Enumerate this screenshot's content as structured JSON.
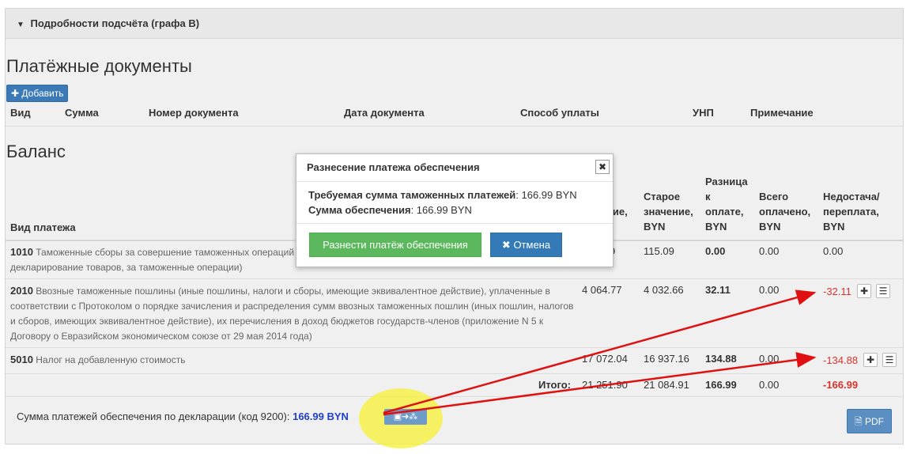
{
  "details_bar": {
    "arrow": "▼",
    "label": "Подробности подсчёта (графа В)"
  },
  "payment_docs": {
    "title": "Платёжные документы",
    "add_label": "Добавить",
    "columns": [
      "Вид",
      "Сумма",
      "Номер документа",
      "Дата документа",
      "Способ уплаты",
      "УНП",
      "Примечание"
    ]
  },
  "balance": {
    "title": "Баланс",
    "columns": {
      "type": "Вид платежа",
      "new_value_line1": "е",
      "new_value_line2": "ние,",
      "old_value": [
        "Старое",
        "значение,",
        "BYN"
      ],
      "difference": [
        "Разница",
        "к",
        "оплате,",
        "BYN"
      ],
      "paid_total": [
        "Всего",
        "оплачено,",
        "BYN"
      ],
      "shortage": [
        "Недостача/",
        "переплата,",
        "BYN"
      ]
    },
    "rows": [
      {
        "code": "1010",
        "desc_line1": "Таможенные сборы за совершение таможенных операций",
        "desc_line2": "декларирование товаров, за таможенные операции)",
        "new_value": "9",
        "old_value": "115.09",
        "difference": "0.00",
        "paid": "0.00",
        "shortage": "0.00"
      },
      {
        "code": "2010",
        "desc_line1": "Ввозные таможенные пошлины (иные пошлины, налоги и сборы, имеющие эквивалентное действие), уплаченные в",
        "desc_line2": "соответствии с Протоколом о порядке зачисления и распределения сумм ввозных таможенных пошлин (иных пошлин, налогов",
        "desc_line3": "и сборов, имеющих эквивалентное действие), их перечисления в доход бюджетов государств-членов (приложение N 5 к",
        "desc_line4": "Договору о Евразийском экономическом союзе от 29 мая 2014 года)",
        "new_value": "4 064.77",
        "old_value": "4 032.66",
        "difference": "32.11",
        "paid": "0.00",
        "shortage": "-32.11"
      },
      {
        "code": "5010",
        "desc_line1": "Налог на добавленную стоимость",
        "new_value": "17 072.04",
        "old_value": "16 937.16",
        "difference": "134.88",
        "paid": "0.00",
        "shortage": "-134.88"
      }
    ],
    "total": {
      "label": "Итого:",
      "new_value": "21 251.90",
      "old_value": "21 084.91",
      "difference": "166.99",
      "paid": "0.00",
      "shortage": "-166.99"
    }
  },
  "footer": {
    "text": "Сумма платежей обеспечения по декларации (код 9200):",
    "amount": "166.99 BYN",
    "pdf_label": "PDF"
  },
  "modal": {
    "title": "Разнесение платежа обеспечения",
    "close": "✖",
    "required_label": "Требуемая сумма таможенных платежей",
    "required_value": ": 166.99 BYN",
    "security_label": "Сумма обеспечения",
    "security_value": ": 166.99 BYN",
    "apply_label": "Разнести платёж обеспечения",
    "cancel_label": "Отмена"
  },
  "colors": {
    "accent": "#337ab7",
    "success": "#5cb85c",
    "negative": "#d9332b",
    "highlight": "#f7f13a",
    "annotation_arrow": "#e01010"
  }
}
